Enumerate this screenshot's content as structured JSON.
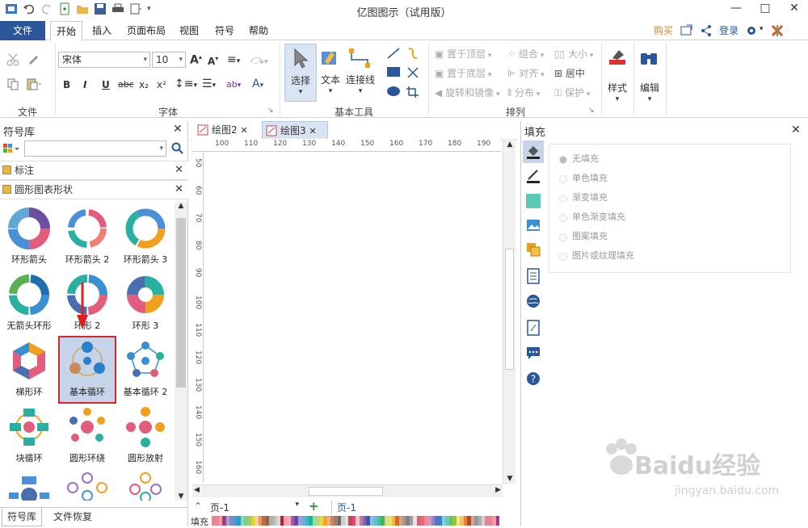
{
  "window": {
    "title": "亿图图示（试用版）",
    "minimize": "—",
    "maximize": "□",
    "close": "✕"
  },
  "ribbon_tabs": [
    {
      "label": "文件"
    },
    {
      "label": "开始"
    },
    {
      "label": "插入"
    },
    {
      "label": "页面布局"
    },
    {
      "label": "视图"
    },
    {
      "label": "符号"
    },
    {
      "label": "帮助"
    }
  ],
  "topright": {
    "buy": "购买",
    "login": "登录"
  },
  "ribbon": {
    "file_group": "文件",
    "font_group": "字体",
    "font_name": "宋体",
    "font_size": "10",
    "basic_tools_group": "基本工具",
    "select": "选择",
    "text": "文本",
    "connector": "连接线",
    "arrange_group": "排列",
    "bring_front": "置于顶层",
    "send_back": "置于底层",
    "rotate_mirror": "旋转和镜像",
    "group": "组合",
    "align": "对齐",
    "distribute": "分布",
    "size": "大小",
    "center": "居中",
    "protect": "保护",
    "style": "样式",
    "edit": "编辑",
    "fmt_bold": "B",
    "fmt_italic": "I",
    "fmt_underline": "U",
    "fmt_abc": "abc",
    "fmt_sub": "x₂",
    "fmt_sup": "x²"
  },
  "left_panel": {
    "title": "符号库",
    "search_placeholder": "",
    "sections": [
      {
        "label": "标注"
      },
      {
        "label": "圆形图表形状"
      }
    ],
    "shapes": [
      {
        "label": "环形箭头"
      },
      {
        "label": "环形箭头 2"
      },
      {
        "label": "环形箭头 3"
      },
      {
        "label": "无箭头环形"
      },
      {
        "label": "环形 2"
      },
      {
        "label": "环形 3"
      },
      {
        "label": "梯形环"
      },
      {
        "label": "基本循环"
      },
      {
        "label": "基本循环 2"
      },
      {
        "label": "块循环"
      },
      {
        "label": "圆形环绕"
      },
      {
        "label": "圆形放射"
      },
      {
        "label": ""
      },
      {
        "label": ""
      },
      {
        "label": ""
      }
    ],
    "bottom_tabs": [
      {
        "label": "符号库"
      },
      {
        "label": "文件恢复"
      }
    ]
  },
  "doc_tabs": [
    {
      "label": "绘图2"
    },
    {
      "label": "绘图3"
    }
  ],
  "ruler": {
    "h": [
      "100",
      "110",
      "120",
      "130",
      "140",
      "150",
      "160",
      "170",
      "180",
      "190"
    ],
    "v": [
      "50",
      "60",
      "70",
      "80",
      "90",
      "100",
      "110",
      "120",
      "130",
      "140",
      "150",
      "160"
    ]
  },
  "status": {
    "page_selector": "页-1",
    "page_tab": "页-1",
    "fill_label": "填充"
  },
  "right_panel": {
    "title": "填充",
    "options": [
      {
        "label": "无填充",
        "selected": true
      },
      {
        "label": "单色填充"
      },
      {
        "label": "渐变填充"
      },
      {
        "label": "单色渐变填充"
      },
      {
        "label": "图案填充"
      },
      {
        "label": "图片或纹理填充"
      }
    ]
  },
  "watermark": {
    "line1": "Baidu经验",
    "line2": "jingyan.baidu.com"
  }
}
